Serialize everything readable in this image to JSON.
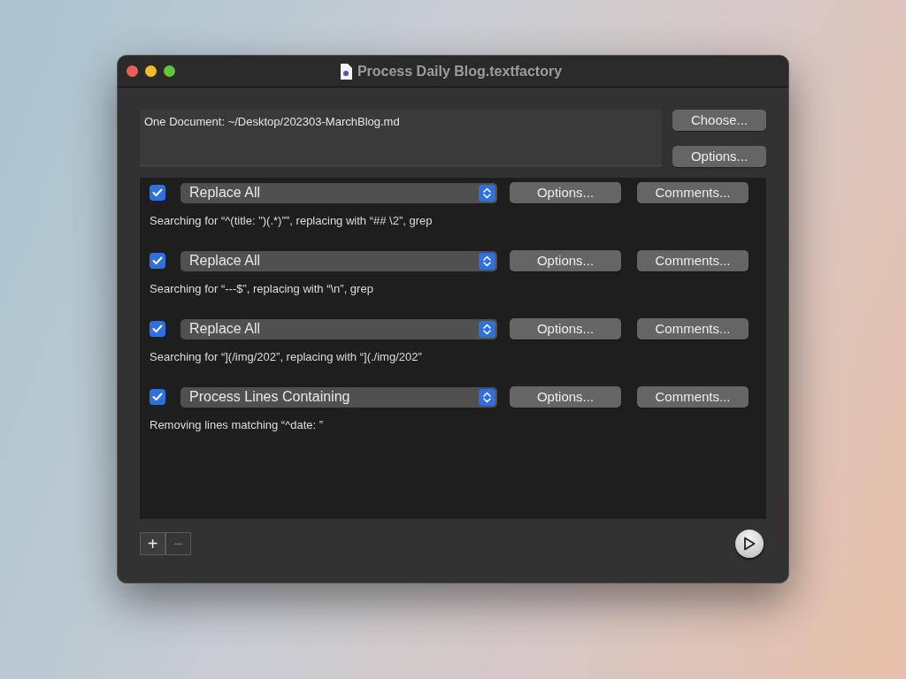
{
  "window": {
    "title": "Process Daily Blog.textfactory"
  },
  "source": {
    "text": "One Document: ~/Desktop/202303-MarchBlog.md",
    "buttons": [
      "Choose...",
      "Options..."
    ]
  },
  "actions": [
    {
      "checked": true,
      "action": "Replace All",
      "options": "Options...",
      "comments": "Comments...",
      "description": "Searching for “^(title: \")(.*)\"”, replacing with “## \\2”, grep"
    },
    {
      "checked": true,
      "action": "Replace All",
      "options": "Options...",
      "comments": "Comments...",
      "description": "Searching for “---$”, replacing with “\\n”, grep"
    },
    {
      "checked": true,
      "action": "Replace All",
      "options": "Options...",
      "comments": "Comments...",
      "description": "Searching for “](/img/202”, replacing with “](./img/202”"
    },
    {
      "checked": true,
      "action": "Process Lines Containing",
      "options": "Options...",
      "comments": "Comments...",
      "description": "Removing lines matching “^date: ”"
    }
  ],
  "footer": {
    "add": {
      "label": "+",
      "disabled": false
    },
    "remove": {
      "label": "−",
      "disabled": true
    }
  }
}
